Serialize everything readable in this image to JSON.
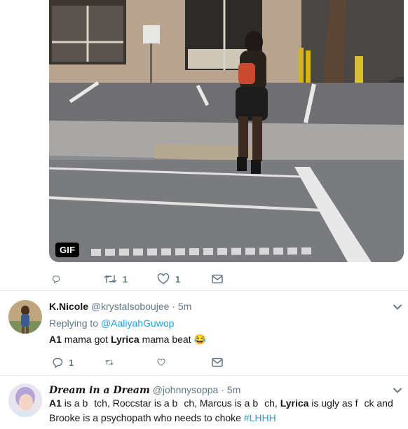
{
  "media": {
    "badge": "GIF",
    "replies": "",
    "retweets": "1",
    "likes": "1"
  },
  "tweet1": {
    "name": "K.Nicole",
    "handle": "@krystalsoboujee",
    "sep": "·",
    "time": "5m",
    "replying_label": "Replying to",
    "replying_handle": "@AaliyahGuwop",
    "text_a1": "A1",
    "text_mid": "mama got",
    "text_lyrica": "Lyrica",
    "text_end": "mama beat",
    "emoji": "😂",
    "replies": "1",
    "retweets": "",
    "likes": ""
  },
  "tweet2": {
    "name": "Dream in a Dream",
    "handle": "@johnnysoppa",
    "sep": "·",
    "time": "5m",
    "l1_a1": "A1",
    "l1_p1": "is a b",
    "l1_p2": "tch, Roccstar is a b",
    "l1_p3": "ch, Marcus is a b",
    "l1_p4": "ch,",
    "l1_lyrica": "Lyrica",
    "l1_p5": "is ugly as f",
    "l1_p6": "ck and",
    "l2_text": "Brooke is a psychopath who needs to choke",
    "l2_hashtag": "#LHHH"
  },
  "colors": {
    "link": "#1da1f2",
    "muted": "#657786",
    "text": "#14171a",
    "divider": "#e6ecf0"
  },
  "icons": {
    "reply": "reply-icon",
    "retweet": "retweet-icon",
    "like": "heart-icon",
    "dm": "envelope-icon",
    "more": "chevron-down-icon"
  }
}
